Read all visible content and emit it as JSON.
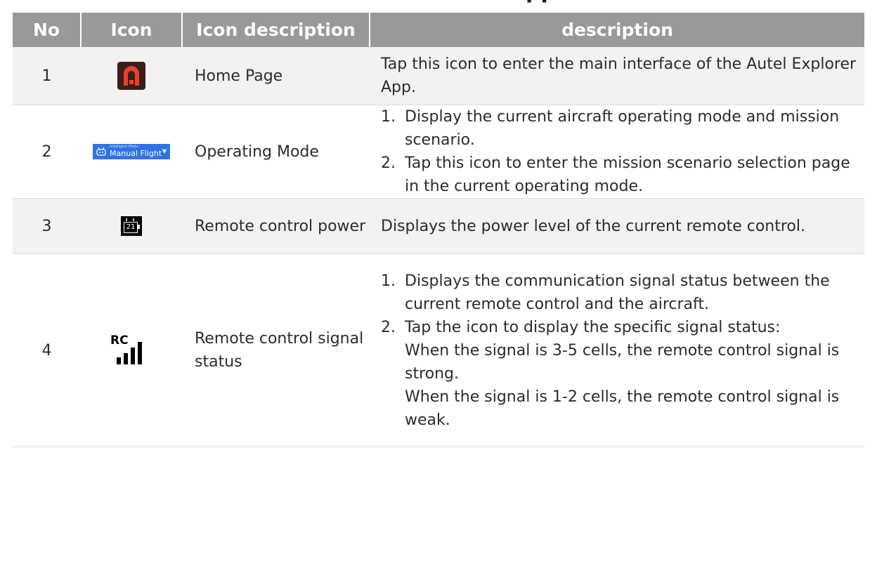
{
  "heading_fragment": "pp",
  "table": {
    "headers": [
      "No",
      "Icon",
      "Icon description",
      "description"
    ],
    "rows": [
      {
        "no": "1",
        "icon": "autel-home-icon",
        "label": "Home Page",
        "description": "Tap this icon to enter the main interface of the Autel Explorer App."
      },
      {
        "no": "2",
        "icon": "operating-mode-icon",
        "icon_text": {
          "sub": "Intelligent Photo",
          "main": "Manual Flight"
        },
        "label": "Operating Mode",
        "items": [
          {
            "n": "1.",
            "t": "Display the current aircraft operating mode and mission scenario."
          },
          {
            "n": "2.",
            "t": "Tap this icon to enter the mission scenario selection page in the current operating mode."
          }
        ]
      },
      {
        "no": "3",
        "icon": "rc-battery-icon",
        "icon_text": {
          "value": "21"
        },
        "label": "Remote control power",
        "description": "Displays the power level of the current remote control."
      },
      {
        "no": "4",
        "icon": "rc-signal-icon",
        "icon_text": {
          "label": "RC"
        },
        "label": "Remote control signal status",
        "items": [
          {
            "n": "1.",
            "t": "Displays the communication signal status between the current remote control and the aircraft."
          },
          {
            "n": "2.",
            "t": "Tap the icon to display the specific signal status:"
          }
        ],
        "notes": [
          "When the signal is 3-5 cells, the remote control signal is strong.",
          "When the signal is 1-2 cells, the remote control signal is weak."
        ]
      }
    ]
  },
  "colors": {
    "header_bg": "#999999",
    "row_alt_bg": "#f2f2f2",
    "home_icon_bg": "#3a1e18",
    "home_icon_fg": "#e8402c",
    "mode_icon_bg": "#2f73e8"
  }
}
